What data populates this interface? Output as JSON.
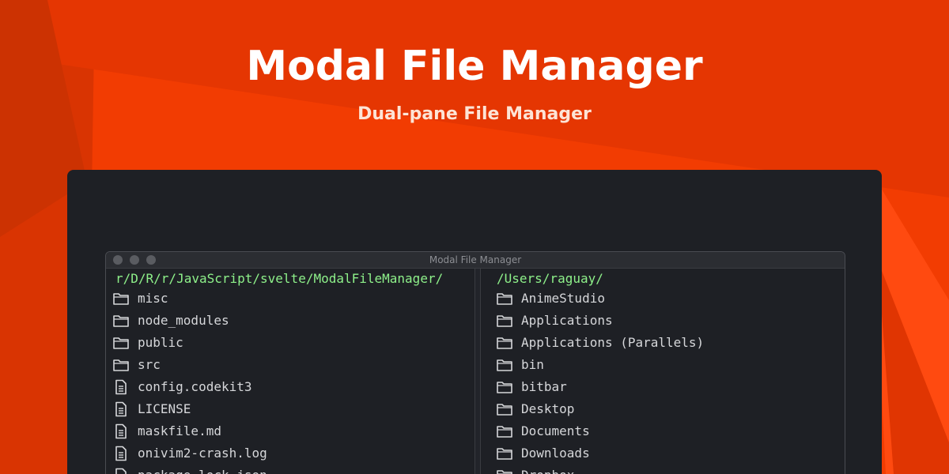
{
  "hero": {
    "title": "Modal File Manager",
    "subtitle": "Dual-pane File Manager"
  },
  "colors": {
    "background": "#f23c02",
    "panel": "#1e2025",
    "path_text": "#8ef18a",
    "file_text": "#d6d7da"
  },
  "window": {
    "title": "Modal File Manager"
  },
  "left_pane": {
    "path": "r/D/R/r/JavaScript/svelte/ModalFileManager/",
    "items": [
      {
        "name": "misc",
        "icon": "folder-icon"
      },
      {
        "name": "node_modules",
        "icon": "folder-icon"
      },
      {
        "name": "public",
        "icon": "folder-icon"
      },
      {
        "name": "src",
        "icon": "folder-icon"
      },
      {
        "name": "config.codekit3",
        "icon": "file-icon"
      },
      {
        "name": "LICENSE",
        "icon": "file-icon"
      },
      {
        "name": "maskfile.md",
        "icon": "file-icon"
      },
      {
        "name": "onivim2-crash.log",
        "icon": "file-icon"
      },
      {
        "name": "package-lock.json",
        "icon": "file-icon"
      }
    ]
  },
  "right_pane": {
    "path": "/Users/raguay/",
    "items": [
      {
        "name": "AnimeStudio",
        "icon": "folder-icon"
      },
      {
        "name": "Applications",
        "icon": "folder-icon"
      },
      {
        "name": "Applications (Parallels)",
        "icon": "folder-icon"
      },
      {
        "name": "bin",
        "icon": "folder-icon"
      },
      {
        "name": "bitbar",
        "icon": "folder-icon"
      },
      {
        "name": "Desktop",
        "icon": "folder-icon"
      },
      {
        "name": "Documents",
        "icon": "folder-icon"
      },
      {
        "name": "Downloads",
        "icon": "folder-icon"
      },
      {
        "name": "Dropbox",
        "icon": "folder-icon"
      }
    ]
  }
}
